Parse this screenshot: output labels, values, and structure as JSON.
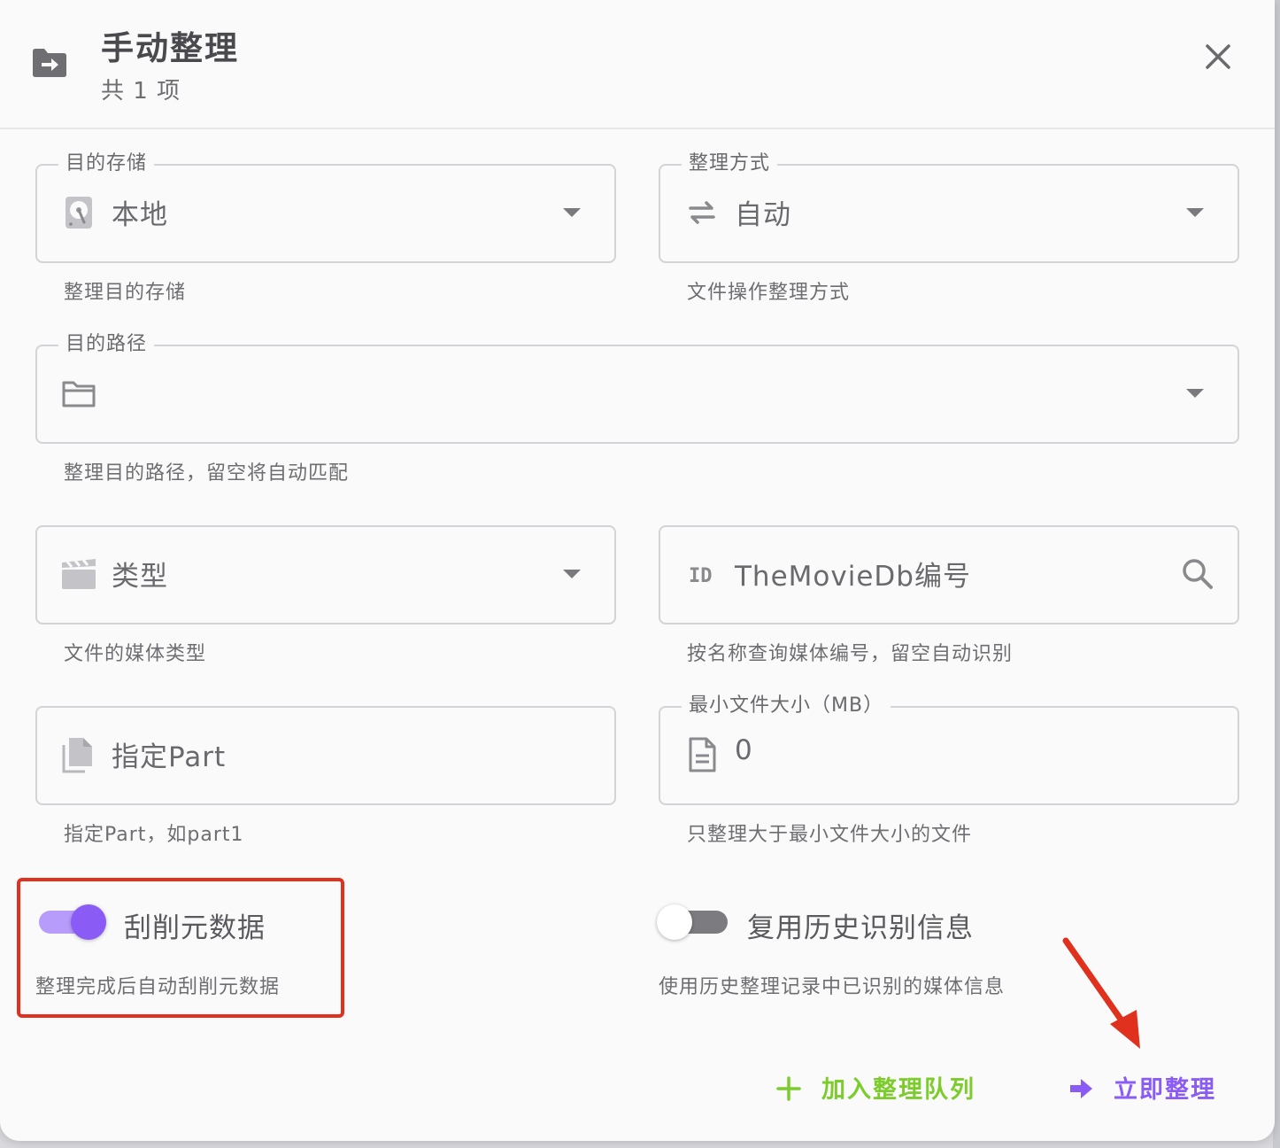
{
  "dialog": {
    "title": "手动整理",
    "subtitle": "共 1 项"
  },
  "storage": {
    "legend": "目的存储",
    "value": "本地",
    "hint": "整理目的存储",
    "icon": "hard-disk-icon"
  },
  "transfer_type": {
    "legend": "整理方式",
    "value": "自动",
    "hint": "文件操作整理方式",
    "icon": "swap-arrows-icon"
  },
  "target_path": {
    "legend": "目的路径",
    "value": "",
    "hint": "整理目的路径，留空将自动匹配",
    "icon": "folder-icon"
  },
  "media_type": {
    "placeholder": "类型",
    "hint": "文件的媒体类型",
    "icon": "clapperboard-icon"
  },
  "tmdb_id": {
    "placeholder": "TheMovieDb编号",
    "hint": "按名称查询媒体编号，留空自动识别",
    "icon": "id-icon"
  },
  "episode_part": {
    "placeholder": "指定Part",
    "hint": "指定Part，如part1",
    "icon": "files-icon"
  },
  "min_filesize": {
    "legend": "最小文件大小（MB）",
    "value": "0",
    "hint": "只整理大于最小文件大小的文件",
    "icon": "document-icon"
  },
  "scrape": {
    "label": "刮削元数据",
    "hint": "整理完成后自动刮削元数据",
    "enabled": true
  },
  "from_history": {
    "label": "复用历史识别信息",
    "hint": "使用历史整理记录中已识别的媒体信息",
    "enabled": false
  },
  "actions": {
    "queue_label": "加入整理队列",
    "now_label": "立即整理"
  },
  "colors": {
    "accent": "#8a5cf5",
    "success": "#7ccc2c",
    "annotation": "#e0301e"
  }
}
